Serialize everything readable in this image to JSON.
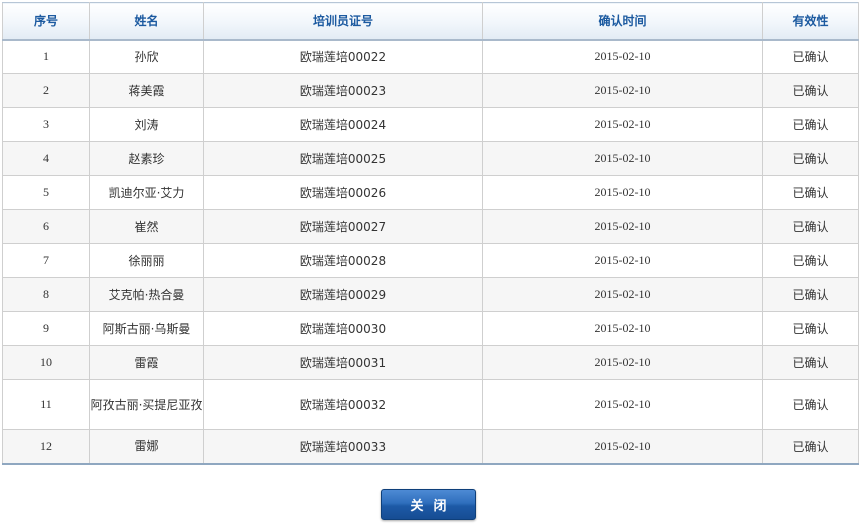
{
  "table": {
    "headers": {
      "seq": "序号",
      "name": "姓名",
      "cert_no": "培训员证号",
      "confirm_time": "确认时间",
      "validity": "有效性"
    },
    "rows": [
      {
        "seq": "1",
        "name": "孙欣",
        "cert_no": "欧瑞莲培00022",
        "confirm_time": "2015-02-10",
        "validity": "已确认"
      },
      {
        "seq": "2",
        "name": "蒋美霞",
        "cert_no": "欧瑞莲培00023",
        "confirm_time": "2015-02-10",
        "validity": "已确认"
      },
      {
        "seq": "3",
        "name": "刘涛",
        "cert_no": "欧瑞莲培00024",
        "confirm_time": "2015-02-10",
        "validity": "已确认"
      },
      {
        "seq": "4",
        "name": "赵素珍",
        "cert_no": "欧瑞莲培00025",
        "confirm_time": "2015-02-10",
        "validity": "已确认"
      },
      {
        "seq": "5",
        "name": "凯迪尔亚·艾力",
        "cert_no": "欧瑞莲培00026",
        "confirm_time": "2015-02-10",
        "validity": "已确认"
      },
      {
        "seq": "6",
        "name": "崔然",
        "cert_no": "欧瑞莲培00027",
        "confirm_time": "2015-02-10",
        "validity": "已确认"
      },
      {
        "seq": "7",
        "name": "徐丽丽",
        "cert_no": "欧瑞莲培00028",
        "confirm_time": "2015-02-10",
        "validity": "已确认"
      },
      {
        "seq": "8",
        "name": "艾克帕·热合曼",
        "cert_no": "欧瑞莲培00029",
        "confirm_time": "2015-02-10",
        "validity": "已确认"
      },
      {
        "seq": "9",
        "name": "阿斯古丽·乌斯曼",
        "cert_no": "欧瑞莲培00030",
        "confirm_time": "2015-02-10",
        "validity": "已确认"
      },
      {
        "seq": "10",
        "name": "雷霞",
        "cert_no": "欧瑞莲培00031",
        "confirm_time": "2015-02-10",
        "validity": "已确认"
      },
      {
        "seq": "11",
        "name": "阿孜古丽·买提尼亚孜",
        "cert_no": "欧瑞莲培00032",
        "confirm_time": "2015-02-10",
        "validity": "已确认"
      },
      {
        "seq": "12",
        "name": "雷娜",
        "cert_no": "欧瑞莲培00033",
        "confirm_time": "2015-02-10",
        "validity": "已确认"
      }
    ]
  },
  "actions": {
    "close_label": "关闭"
  },
  "colors": {
    "header_text": "#1c5aa0",
    "button_bg": "#1d5aa7",
    "row_alt_bg": "#f6f6f6"
  }
}
